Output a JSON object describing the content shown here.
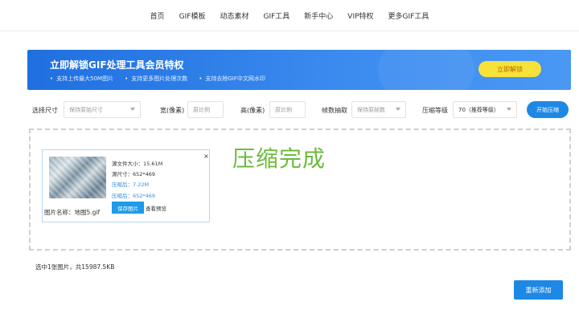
{
  "nav": {
    "items": [
      "首页",
      "GIF模板",
      "动态素材",
      "GIF工具",
      "新手中心",
      "VIP特权",
      "更多GIF工具"
    ]
  },
  "banner": {
    "title": "立即解锁GIF处理工具会员特权",
    "features": [
      "支持上传最大50M图片",
      "支持更多图片处理次数",
      "支持去除GIF中文网水印"
    ],
    "button": "立即解锁"
  },
  "options": {
    "size_label": "选择尺寸",
    "size_value": "保持原始尺寸",
    "width_label": "宽(像素)",
    "width_placeholder": "原比例",
    "height_label": "高(像素)",
    "height_placeholder": "原比例",
    "frame_label": "帧数抽取",
    "frame_value": "保持原帧数",
    "level_label": "压缩等级",
    "level_value": "70（推荐等级）",
    "start_button": "开始压缩"
  },
  "result": {
    "original_size": "源文件大小：15.61M",
    "original_dim": "源尺寸：652*469",
    "compressed_size": "压缩后：7.22M",
    "compressed_dim": "压缩后：652*469",
    "filename": "图片名称：地图5.gif",
    "save_button": "保存图片",
    "preview_link": "查看预览",
    "close": "×",
    "status": "压缩完成"
  },
  "summary": "选中1张图片，共15987.5KB",
  "readd_button": "重新添加",
  "colors": {
    "accent": "#1e88e5",
    "banner_start": "#1f6fe0",
    "unlock_button": "#f7e23a",
    "done_text": "#6cbb3c"
  }
}
